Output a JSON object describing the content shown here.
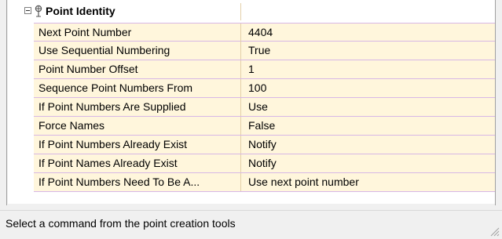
{
  "category": {
    "label": "Point Identity",
    "icon": "point-identity-icon",
    "expander_icon": "collapse-minus-icon"
  },
  "properties": [
    {
      "name": "Next Point Number",
      "value": "4404"
    },
    {
      "name": "Use Sequential Numbering",
      "value": "True"
    },
    {
      "name": "Point Number Offset",
      "value": "1"
    },
    {
      "name": "Sequence Point Numbers From",
      "value": "100"
    },
    {
      "name": "If Point Numbers Are Supplied",
      "value": "Use"
    },
    {
      "name": "Force Names",
      "value": "False"
    },
    {
      "name": "If Point Numbers Already Exist",
      "value": "Notify"
    },
    {
      "name": "If Point Names Already Exist",
      "value": "Notify"
    },
    {
      "name": "If Point Numbers Need To Be A...",
      "value": "Use next point number"
    }
  ],
  "status_bar": {
    "text": "Select a command from the point creation tools"
  },
  "colors": {
    "row_background": "#fff6dc",
    "row_line": "#d7b7e6",
    "column_line": "#e3cfa8"
  }
}
